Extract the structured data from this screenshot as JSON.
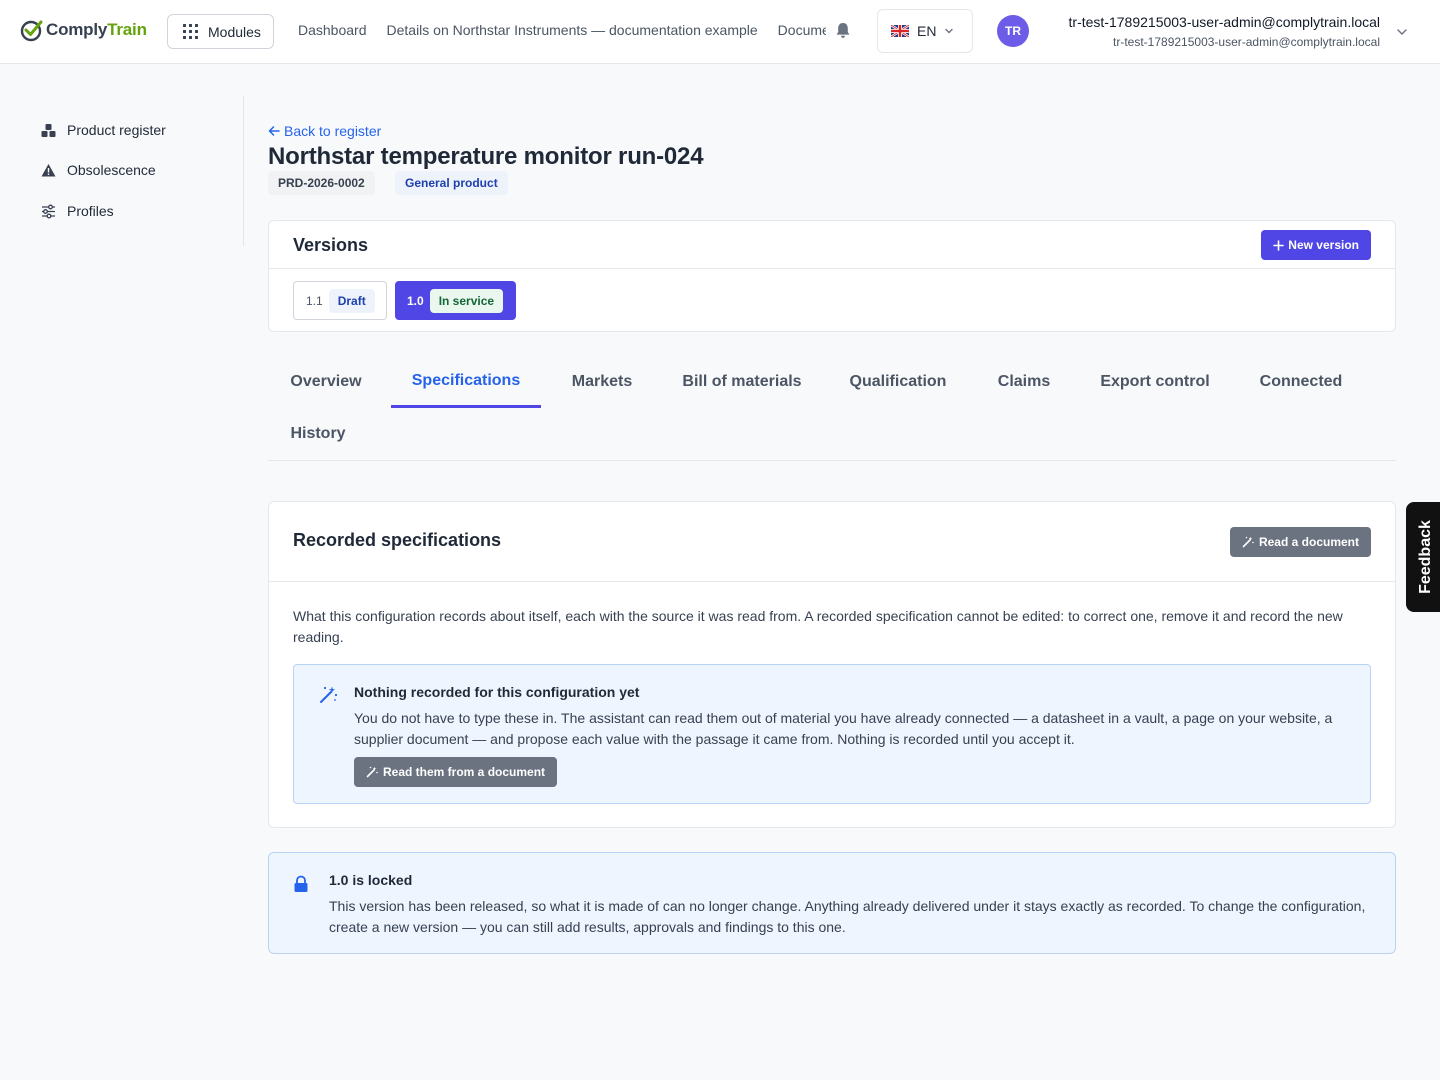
{
  "header": {
    "logo": {
      "part1": "Comply",
      "part2": "Train"
    },
    "modules_label": "Modules",
    "breadcrumbs": [
      "Dashboard",
      "Details on Northstar Instruments — documentation example",
      "Documents"
    ],
    "language": "EN",
    "user": {
      "initials": "TR",
      "name": "tr-test-1789215003-user-admin@complytrain.local",
      "email": "tr-test-1789215003-user-admin@complytrain.local"
    }
  },
  "sidebar": {
    "items": [
      {
        "label": "Product register",
        "icon": "boxes-icon"
      },
      {
        "label": "Obsolescence",
        "icon": "warning-icon"
      },
      {
        "label": "Profiles",
        "icon": "sliders-icon"
      }
    ]
  },
  "page": {
    "back_label": "Back to register",
    "title": "Northstar temperature monitor run-024",
    "product_id": "PRD-2026-0002",
    "product_type": "General product"
  },
  "versions": {
    "title": "Versions",
    "new_version_label": "New version",
    "items": [
      {
        "number": "1.1",
        "status": "Draft",
        "selected": false
      },
      {
        "number": "1.0",
        "status": "In service",
        "selected": true
      }
    ]
  },
  "tabs": [
    {
      "label": "Overview",
      "active": false
    },
    {
      "label": "Specifications",
      "active": true
    },
    {
      "label": "Markets",
      "active": false
    },
    {
      "label": "Bill of materials",
      "active": false
    },
    {
      "label": "Qualification",
      "active": false
    },
    {
      "label": "Claims",
      "active": false
    },
    {
      "label": "Export control",
      "active": false
    },
    {
      "label": "Connected",
      "active": false
    },
    {
      "label": "History",
      "active": false
    }
  ],
  "specifications": {
    "title": "Recorded specifications",
    "read_document_label": "Read a document",
    "description": "What this configuration records about itself, each with the source it was read from. A recorded specification cannot be edited: to correct one, remove it and record the new reading.",
    "empty": {
      "title": "Nothing recorded for this configuration yet",
      "text": "You do not have to type these in. The assistant can read them out of material you have already connected — a datasheet in a vault, a page on your website, a supplier document — and propose each value with the passage it came from. Nothing is recorded until you accept it.",
      "button_label": "Read them from a document"
    }
  },
  "lock_notice": {
    "title": "1.0 is locked",
    "text": "This version has been released, so what it is made of can no longer change. Anything already delivered under it stays exactly as recorded. To change the configuration, create a new version — you can still add results, approvals and findings to this one."
  },
  "feedback_label": "Feedback",
  "colors": {
    "primary": "#4f46e5",
    "link": "#2563eb",
    "brand_green": "#65a30d",
    "info_bg": "#eef5fe"
  }
}
